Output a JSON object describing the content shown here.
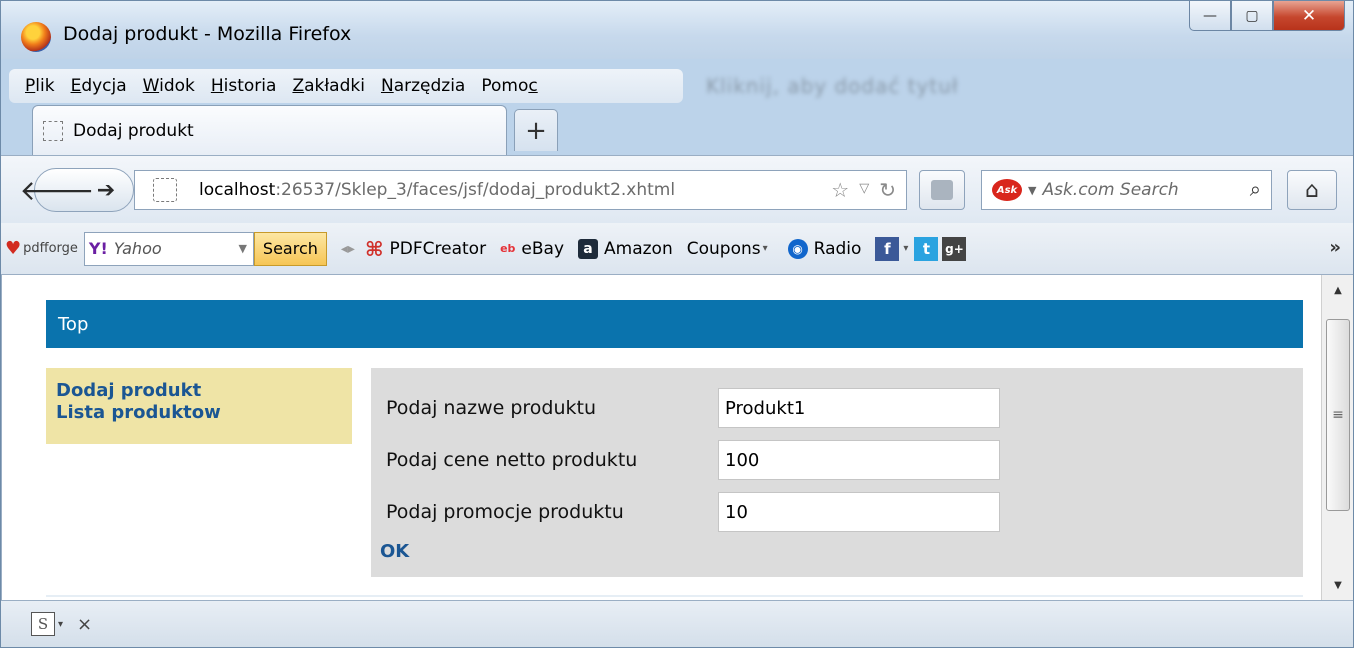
{
  "window": {
    "title": "Dodaj produkt - Mozilla Firefox"
  },
  "menu": [
    "Plik",
    "Edycja",
    "Widok",
    "Historia",
    "Zakładki",
    "Narzędzia",
    "Pomoc"
  ],
  "menu_access": [
    "P",
    "E",
    "W",
    "H",
    "Z",
    "N",
    "c"
  ],
  "background_blur_text": "Kliknij, aby dodać tytuł",
  "tab": {
    "label": "Dodaj produkt",
    "new_tab": "+"
  },
  "nav": {
    "url_host": "localhost",
    "url_rest": ":26537/Sklep_3/faces/jsf/dodaj_produkt2.xhtml",
    "search_placeholder": "Ask.com Search",
    "ask_logo": "Ask"
  },
  "bookmarks": {
    "pdfforge": "pdfforge",
    "yahoo_logo": "Y!",
    "yahoo_text": "Yahoo",
    "search_button": "Search",
    "items": [
      "PDFCreator",
      "eBay",
      "Amazon",
      "Coupons",
      "Radio"
    ],
    "ebay_icon": "eb",
    "amazon_icon": "a",
    "radio_icon": "◉",
    "fb": "f",
    "tw": "t",
    "gp": "g+"
  },
  "page": {
    "top_bar": "Top",
    "left_links": [
      "Dodaj produkt",
      "Lista produktow"
    ],
    "form": {
      "labels": [
        "Podaj nazwe produktu",
        "Podaj cene netto produktu",
        "Podaj promocje produktu"
      ],
      "values": [
        "Produkt1",
        "100",
        "10"
      ],
      "ok": "OK"
    }
  },
  "status": {
    "s_icon": "S",
    "close": "×"
  }
}
